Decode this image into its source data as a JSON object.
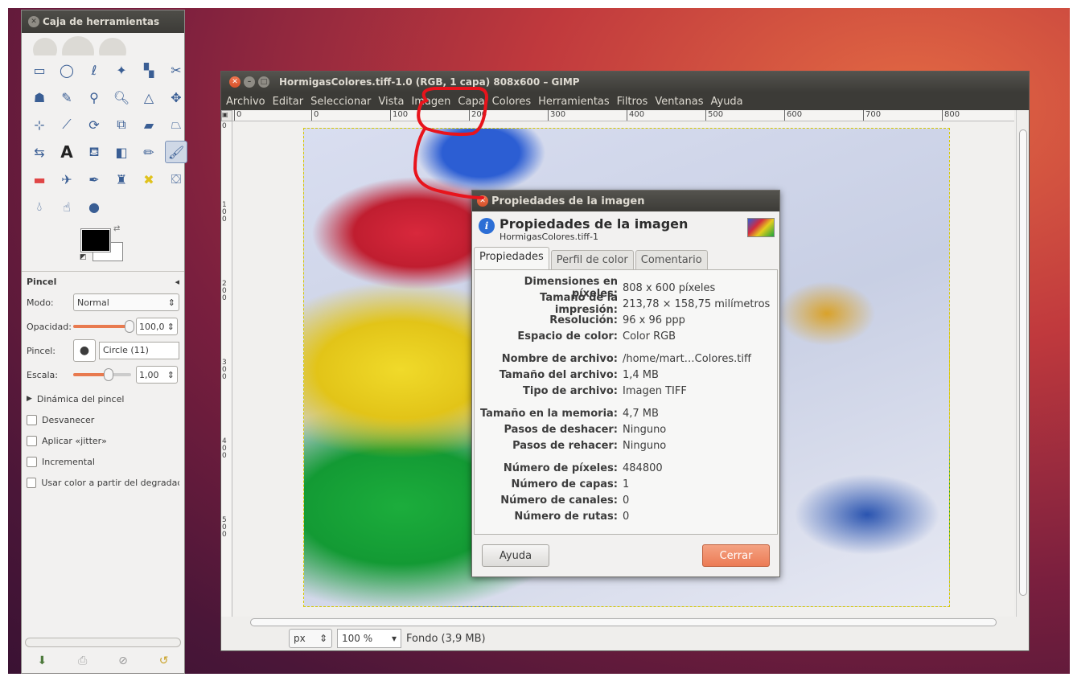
{
  "toolbox": {
    "title": "Caja de herramientas",
    "options": {
      "title": "Pincel",
      "mode_label": "Modo:",
      "mode_value": "Normal",
      "opacity_label": "Opacidad:",
      "opacity_value": "100,0",
      "brush_label": "Pincel:",
      "brush_value": "Circle (11)",
      "scale_label": "Escala:",
      "scale_value": "1,00",
      "dynamics_label": "Dinámica del pincel",
      "checks": [
        "Desvanecer",
        "Aplicar «jitter»",
        "Incremental",
        "Usar color a partir del degradado"
      ]
    }
  },
  "image_window": {
    "title": "HormigasColores.tiff-1.0 (RGB, 1 capa) 808x600 – GIMP",
    "menu": [
      "Archivo",
      "Editar",
      "Seleccionar",
      "Vista",
      "Imagen",
      "Capa",
      "Colores",
      "Herramientas",
      "Filtros",
      "Ventanas",
      "Ayuda"
    ],
    "hruler_ticks": [
      "0",
      "0",
      "100",
      "200",
      "300",
      "400",
      "500",
      "600",
      "700",
      "800"
    ],
    "vruler_ticks": [
      "0",
      "100",
      "200",
      "300",
      "400",
      "500"
    ],
    "status": {
      "unit": "px",
      "zoom": "100 %",
      "layer_info": "Fondo (3,9 MB)"
    }
  },
  "dialog": {
    "titlebar": "Propiedades de la imagen",
    "title": "Propiedades de la imagen",
    "subtitle": "HormigasColores.tiff-1",
    "tabs": [
      "Propiedades",
      "Perfil de color",
      "Comentario"
    ],
    "groups": [
      [
        {
          "k": "Dimensiones en píxeles:",
          "v": "808 x 600 píxeles"
        },
        {
          "k": "Tamaño de la impresión:",
          "v": "213,78 × 158,75 milímetros"
        },
        {
          "k": "Resolución:",
          "v": "96 x 96 ppp"
        },
        {
          "k": "Espacio de color:",
          "v": "Color RGB"
        }
      ],
      [
        {
          "k": "Nombre de archivo:",
          "v": "/home/mart…Colores.tiff"
        },
        {
          "k": "Tamaño del archivo:",
          "v": "1,4 MB"
        },
        {
          "k": "Tipo de archivo:",
          "v": "Imagen TIFF"
        }
      ],
      [
        {
          "k": "Tamaño en la memoria:",
          "v": "4,7 MB"
        },
        {
          "k": "Pasos de deshacer:",
          "v": "Ninguno"
        },
        {
          "k": "Pasos de rehacer:",
          "v": "Ninguno"
        }
      ],
      [
        {
          "k": "Número de píxeles:",
          "v": "484800"
        },
        {
          "k": "Número de capas:",
          "v": "1"
        },
        {
          "k": "Número de canales:",
          "v": "0"
        },
        {
          "k": "Número de rutas:",
          "v": "0"
        }
      ]
    ],
    "help_button": "Ayuda",
    "close_button": "Cerrar"
  }
}
